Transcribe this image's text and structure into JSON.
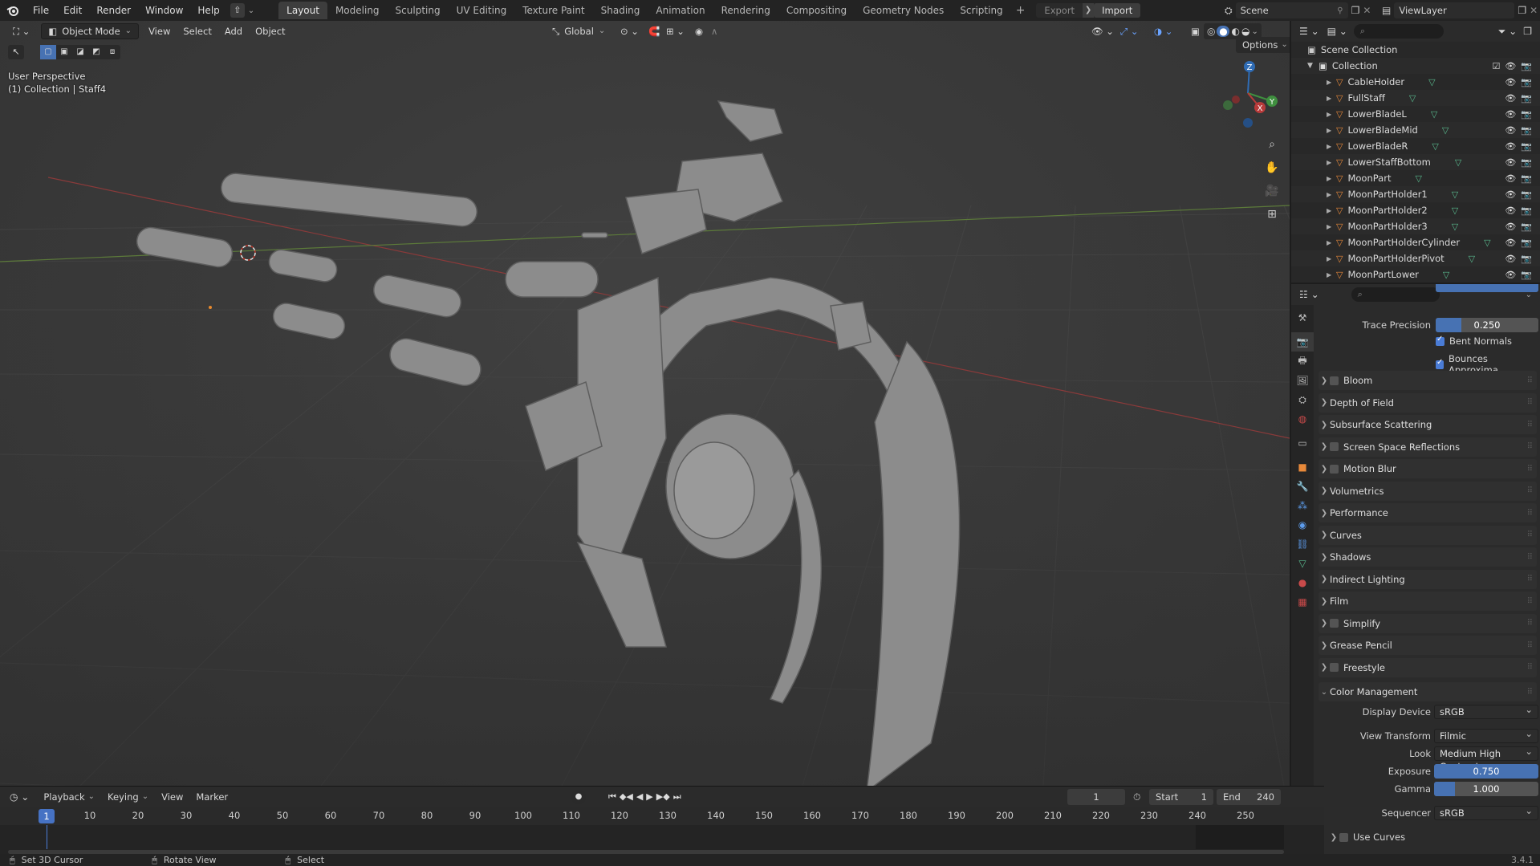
{
  "topbar": {
    "menus": [
      "File",
      "Edit",
      "Render",
      "Window",
      "Help"
    ],
    "workspaces": [
      "Layout",
      "Modeling",
      "Sculpting",
      "UV Editing",
      "Texture Paint",
      "Shading",
      "Animation",
      "Rendering",
      "Compositing",
      "Geometry Nodes",
      "Scripting"
    ],
    "active_workspace": "Layout",
    "export_label": "Export",
    "import_label": "Import",
    "scene_name": "Scene",
    "view_layer": "ViewLayer"
  },
  "viewport": {
    "mode": "Object Mode",
    "menus": [
      "View",
      "Select",
      "Add",
      "Object"
    ],
    "transform_orientation": "Global",
    "options_label": "Options",
    "perspective_label": "User Perspective",
    "collection_label": "(1) Collection | Staff4",
    "gizmo_axes": {
      "x": "X",
      "y": "Y",
      "z": "Z"
    }
  },
  "outliner": {
    "scene_collection": "Scene Collection",
    "collection": "Collection",
    "items": [
      "CableHolder",
      "FullStaff",
      "LowerBladeL",
      "LowerBladeMid",
      "LowerBladeR",
      "LowerStaffBottom",
      "MoonPart",
      "MoonPartHolder1",
      "MoonPartHolder2",
      "MoonPartHolder3",
      "MoonPartHolderCylinder",
      "MoonPartHolderPivot",
      "MoonPartLower"
    ]
  },
  "properties": {
    "trace_precision_label": "Trace Precision",
    "trace_precision_value": "0.250",
    "trace_precision_fraction": 0.25,
    "bent_normals": "Bent Normals",
    "bounces_approx": "Bounces Approxima...",
    "panels": [
      {
        "label": "Bloom",
        "checkbox": true
      },
      {
        "label": "Depth of Field",
        "checkbox": false
      },
      {
        "label": "Subsurface Scattering",
        "checkbox": false
      },
      {
        "label": "Screen Space Reflections",
        "checkbox": true
      },
      {
        "label": "Motion Blur",
        "checkbox": true
      },
      {
        "label": "Volumetrics",
        "checkbox": false
      },
      {
        "label": "Performance",
        "checkbox": false
      },
      {
        "label": "Curves",
        "checkbox": false
      },
      {
        "label": "Shadows",
        "checkbox": false
      },
      {
        "label": "Indirect Lighting",
        "checkbox": false
      },
      {
        "label": "Film",
        "checkbox": false
      },
      {
        "label": "Simplify",
        "checkbox": true
      },
      {
        "label": "Grease Pencil",
        "checkbox": false
      },
      {
        "label": "Freestyle",
        "checkbox": true
      }
    ],
    "color_management": {
      "title": "Color Management",
      "display_device_label": "Display Device",
      "display_device": "sRGB",
      "view_transform_label": "View Transform",
      "view_transform": "Filmic",
      "look_label": "Look",
      "look": "Medium High Contrast",
      "exposure_label": "Exposure",
      "exposure": "0.750",
      "gamma_label": "Gamma",
      "gamma": "1.000",
      "sequencer_label": "Sequencer",
      "sequencer": "sRGB",
      "use_curves": "Use Curves"
    }
  },
  "timeline": {
    "menus": [
      "Playback",
      "Keying",
      "View",
      "Marker"
    ],
    "current_frame": "1",
    "start_label": "Start",
    "start": "1",
    "end_label": "End",
    "end": "240",
    "ticks": [
      "1",
      "10",
      "20",
      "30",
      "40",
      "50",
      "60",
      "70",
      "80",
      "90",
      "100",
      "110",
      "120",
      "130",
      "140",
      "150",
      "160",
      "170",
      "180",
      "190",
      "200",
      "210",
      "220",
      "230",
      "240",
      "250"
    ]
  },
  "statusbar": {
    "left": "Set 3D Cursor",
    "middle": "Rotate View",
    "right": "Select",
    "version": "3.4.1"
  },
  "colors": {
    "accent": "#4772b3",
    "object_icon": "#e8893a",
    "mesh_icon": "#59b88d"
  }
}
